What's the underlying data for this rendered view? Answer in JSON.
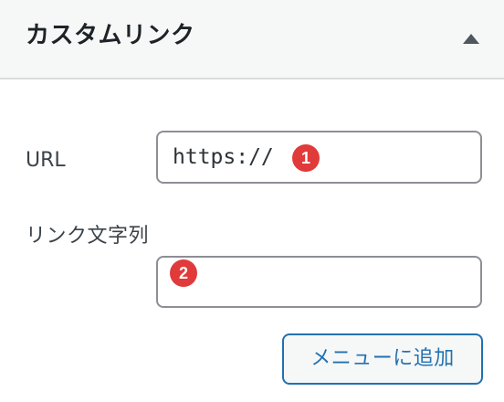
{
  "header": {
    "title": "カスタムリンク",
    "toggle_icon": "triangle-up-icon"
  },
  "form": {
    "url_label": "URL",
    "url_value": "https://",
    "link_text_label": "リンク文字列",
    "link_text_value": ""
  },
  "badges": {
    "first": "1",
    "second": "2"
  },
  "buttons": {
    "add_to_menu": "メニューに追加"
  },
  "colors": {
    "accent": "#2271b1",
    "badge": "#e13a3a"
  }
}
